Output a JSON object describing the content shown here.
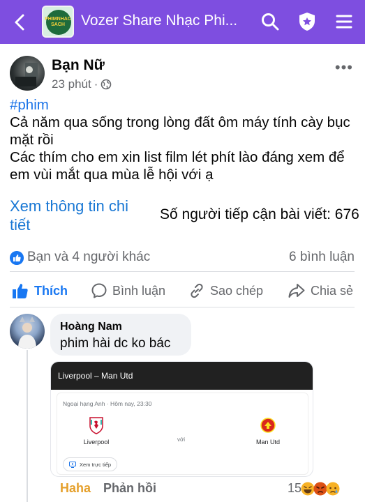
{
  "topbar": {
    "title": "Vozer Share Nhạc Phi...",
    "logo_text": "PHIMNHAC SACH",
    "color": "#7e4ee0"
  },
  "post": {
    "author": "Bạn Nữ",
    "time": "23 phút",
    "audience_icon": "globe-icon",
    "hashtag": "#phim",
    "lines": [
      "Cả năm qua sống trong lòng đất ôm máy tính cày bục",
      "mặt rồi",
      "Các thím cho em xin list film lét phít lào đáng xem để",
      "em vùi mắt qua mùa lễ hội với ạ"
    ],
    "see_details": "Xem thông tin chi tiết",
    "reach": "Số người tiếp cận bài viết: 676"
  },
  "stats": {
    "reactions": "Bạn và 4 người khác",
    "comments": "6 bình luận"
  },
  "actions": {
    "like": "Thích",
    "comment": "Bình luận",
    "copy": "Sao chép",
    "share": "Chia sẻ"
  },
  "comment": {
    "author": "Hoàng Nam",
    "text": "phim hài dc ko bác",
    "attachment": {
      "title": "Liverpool – Man Utd",
      "league": "Ngoại hạng Anh · Hôm nay, 23:30",
      "home": "Liverpool",
      "away": "Man Utd",
      "vs": "với",
      "watch": "Xem trực tiếp"
    },
    "haha": "Haha",
    "reply": "Phản hồi",
    "reaction_count": "15"
  },
  "colors": {
    "accent_blue": "#1877f2",
    "link_blue": "#1877d4",
    "haha_yellow": "#e5a02c",
    "muted": "#65676b"
  }
}
